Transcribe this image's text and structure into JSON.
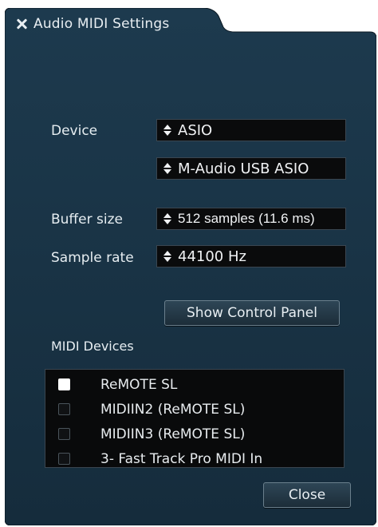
{
  "window": {
    "title": "Audio MIDI Settings"
  },
  "settings": {
    "device_label": "Device",
    "device_type": "ASIO",
    "device_name": "M-Audio USB ASIO",
    "buffer_label": "Buffer size",
    "buffer_value": "512 samples (11.6 ms)",
    "rate_label": "Sample rate",
    "rate_value": "44100 Hz",
    "control_panel_button": "Show Control Panel"
  },
  "midi": {
    "heading": "MIDI Devices",
    "devices": [
      {
        "name": "ReMOTE SL",
        "checked": true
      },
      {
        "name": "MIDIIN2 (ReMOTE SL)",
        "checked": false
      },
      {
        "name": "MIDIIN3 (ReMOTE SL)",
        "checked": false
      },
      {
        "name": "3- Fast Track Pro MIDI In",
        "checked": false
      }
    ]
  },
  "footer": {
    "close_button": "Close"
  },
  "colors": {
    "panel": "#193447",
    "panel_dark": "#0f2230",
    "field": "#0a0b0c",
    "text": "#e6edf1"
  }
}
